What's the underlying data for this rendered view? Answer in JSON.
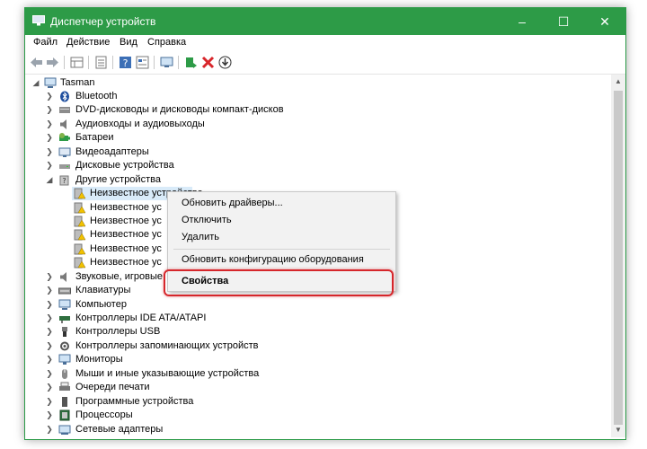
{
  "window": {
    "title": "Диспетчер устройств",
    "minimize_icon": "minimize-icon",
    "maximize_icon": "maximize-icon",
    "close_icon": "close-icon"
  },
  "menu": [
    "Файл",
    "Действие",
    "Вид",
    "Справка"
  ],
  "toolbar": [
    "back-arrow-icon",
    "forward-arrow-icon",
    "properties-grid-icon",
    "list-view-icon",
    "help-icon",
    "details-icon",
    "monitor-icon",
    "update-driver-icon",
    "remove-icon",
    "download-icon"
  ],
  "tree": {
    "root": "Tasman",
    "categories": [
      {
        "label": "Bluetooth",
        "icon": "bluetooth-icon"
      },
      {
        "label": "DVD-дисководы и дисководы компакт-дисков",
        "icon": "dvd-drive-icon"
      },
      {
        "label": "Аудиовходы и аудиовыходы",
        "icon": "speaker-icon"
      },
      {
        "label": "Батареи",
        "icon": "battery-icon"
      },
      {
        "label": "Видеоадаптеры",
        "icon": "display-adapter-icon"
      },
      {
        "label": "Дисковые устройства",
        "icon": "disk-drive-icon"
      },
      {
        "label": "Другие устройства",
        "icon": "other-devices-icon"
      }
    ],
    "other_devices": [
      "Неизвестное устройство",
      "Неизвестное ус",
      "Неизвестное ус",
      "Неизвестное ус",
      "Неизвестное ус",
      "Неизвестное ус"
    ],
    "more_categories": [
      {
        "label": "Звуковые, игровые",
        "icon": "sound-icon"
      },
      {
        "label": "Клавиатуры",
        "icon": "keyboard-icon"
      },
      {
        "label": "Компьютер",
        "icon": "computer-icon"
      },
      {
        "label": "Контроллеры IDE ATA/ATAPI",
        "icon": "ide-controller-icon"
      },
      {
        "label": "Контроллеры USB",
        "icon": "usb-icon"
      },
      {
        "label": "Контроллеры запоминающих устройств",
        "icon": "storage-controller-icon"
      },
      {
        "label": "Мониторы",
        "icon": "monitor-icon"
      },
      {
        "label": "Мыши и иные указывающие устройства",
        "icon": "mouse-icon"
      },
      {
        "label": "Очереди печати",
        "icon": "print-queue-icon"
      },
      {
        "label": "Программные устройства",
        "icon": "software-device-icon"
      },
      {
        "label": "Процессоры",
        "icon": "processor-icon"
      },
      {
        "label": "Сетевые адаптеры",
        "icon": "network-adapter-icon"
      }
    ]
  },
  "context_menu": {
    "update": "Обновить драйверы...",
    "disable": "Отключить",
    "uninstall": "Удалить",
    "scan": "Обновить конфигурацию оборудования",
    "properties": "Свойства"
  },
  "colors": {
    "titlebar": "#2d9b47",
    "highlight": "#d6262b",
    "selection": "#d9ebf9"
  }
}
